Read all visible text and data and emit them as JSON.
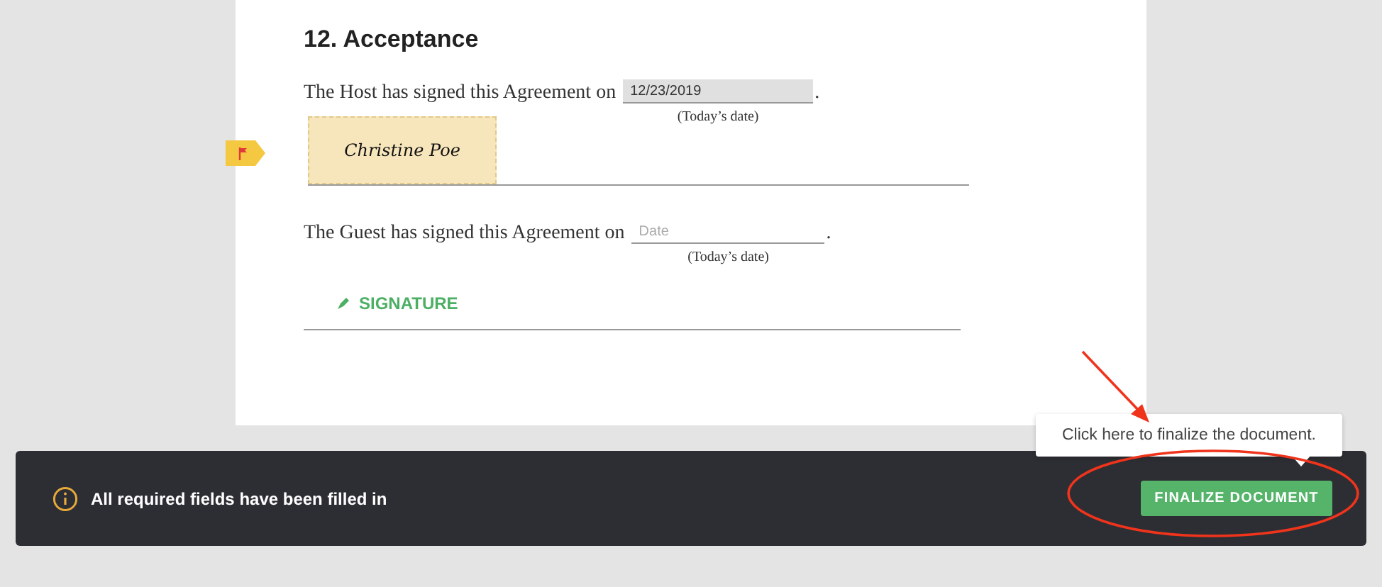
{
  "document": {
    "heading": "12. Acceptance",
    "host": {
      "sentence": "The Host has signed this Agreement on",
      "date_value": "12/23/2019",
      "period": ".",
      "date_caption": "(Today’s date)",
      "signature": "Christine Poe",
      "flagged": true
    },
    "guest": {
      "sentence": "The Guest has signed this Agreement on",
      "date_placeholder": "Date",
      "period": ".",
      "date_caption": "(Today’s date)",
      "signature_button": "SIGNATURE"
    }
  },
  "status_bar": {
    "message": "All required fields have been filled in",
    "button": "FINALIZE DOCUMENT"
  },
  "tooltip": {
    "text": "Click here to finalize the document."
  }
}
